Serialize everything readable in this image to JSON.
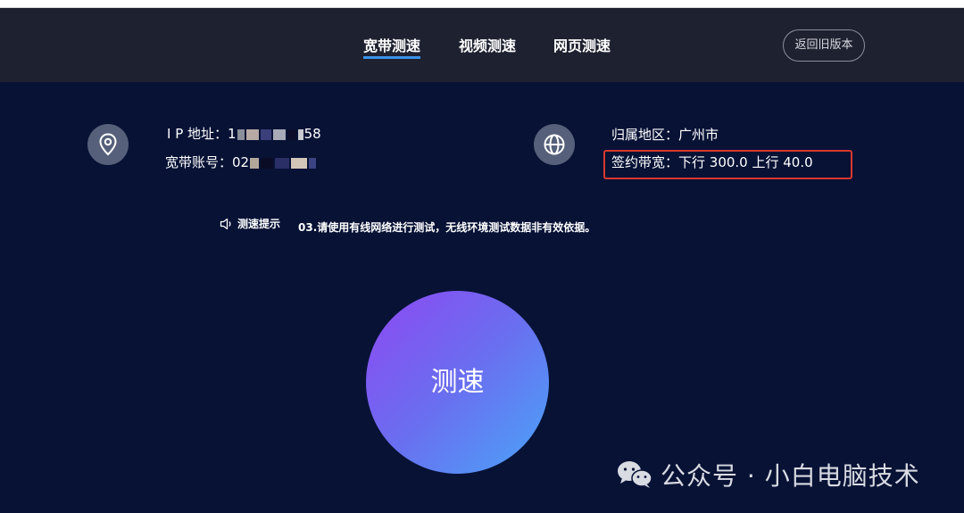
{
  "nav": {
    "tabs": [
      {
        "label": "宽带测速",
        "active": true
      },
      {
        "label": "视频测速",
        "active": false
      },
      {
        "label": "网页测速",
        "active": false
      }
    ],
    "old_version_label": "返回旧版本"
  },
  "account": {
    "ip_label": "I P  地址：",
    "ip_value_start": "1",
    "ip_value_end": "58",
    "broadband_label": "宽带账号：",
    "broadband_value_start": "02",
    "region_label": "归属地区：",
    "region_value": "广州市",
    "contract_label": "签约带宽：",
    "contract_value": "下行 300.0 上行 40.0"
  },
  "tip": {
    "label": "测速提示",
    "text": "03.请使用有线网络进行测试，无线环境测试数据非有效依据。"
  },
  "speed_button_label": "测速",
  "watermark": "公众号 · 小白电脑技术",
  "colors": {
    "header_bg": "#1e2130",
    "main_bg": "#071235",
    "tab_underline": "#3a93ea",
    "highlight_box": "#d9382e",
    "button_gradient_start": "#8e48f2",
    "button_gradient_end": "#4aa5f8"
  },
  "icons": {
    "location": "location-pin-icon",
    "globe": "globe-icon",
    "speaker": "speaker-icon",
    "wechat": "wechat-icon"
  }
}
